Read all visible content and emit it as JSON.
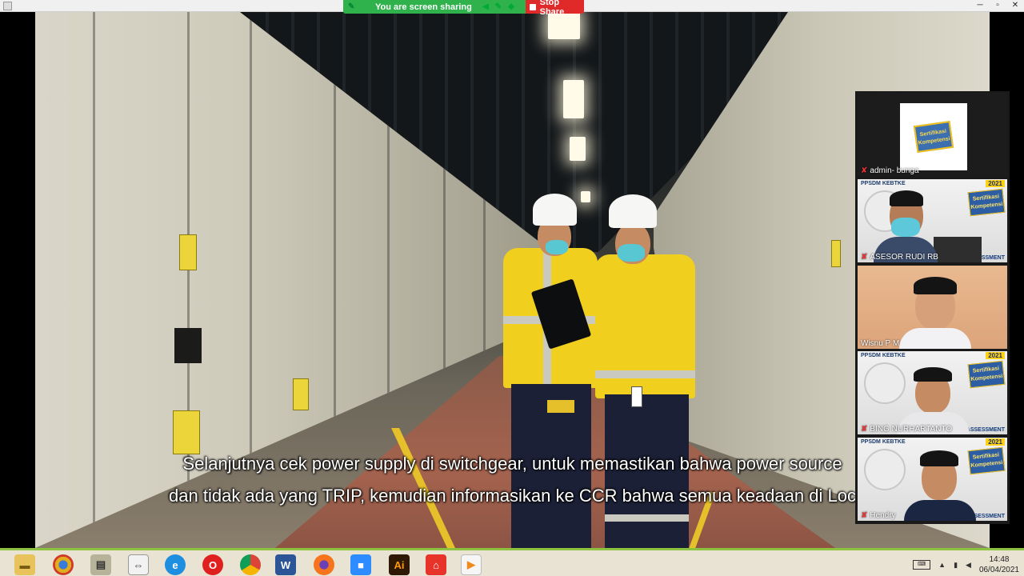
{
  "share_banner": {
    "status_text": "You are screen sharing",
    "stop_label": "Stop Share"
  },
  "subtitles": [
    "Selanjutnya cek power supply di switchgear, untuk memastikan bahwa power source",
    "dan tidak ada yang TRIP, kemudian informasikan ke CCR bahwa semua keadaan di Loc"
  ],
  "participants": [
    {
      "name": "admin- bunga",
      "muted": true,
      "kind": "logo",
      "logo_text": "Sertifikasi Kompetensi"
    },
    {
      "name": "ASESOR RUDI RB",
      "muted": true,
      "kind": "studio",
      "brand": "PPSDM KEBTKE",
      "year": "2021",
      "cert": "Sertifikasi Kompetensi",
      "dist": "DISTANCE ASSESSMENT"
    },
    {
      "name": "Wisnu P M",
      "muted": false,
      "kind": "room"
    },
    {
      "name": "BING NURHARTANTO",
      "muted": true,
      "kind": "studio",
      "brand": "PPSDM KEBTKE",
      "year": "2021",
      "cert": "Sertifikasi Kompetensi",
      "dist": "DISTANCE ASSESSMENT"
    },
    {
      "name": "Hendry",
      "muted": true,
      "kind": "studio",
      "brand": "PPSDM KEBTKE",
      "year": "2021",
      "cert": "Sertifikasi Kompetensi",
      "dist": "DISTANCE ASSESSMENT"
    }
  ],
  "taskbar": {
    "apps": [
      "file-explorer",
      "chrome-legacy",
      "archive-manager",
      "teamviewer",
      "internet-explorer",
      "opera",
      "chrome",
      "word",
      "firefox",
      "zoom",
      "illustrator",
      "acrobat",
      "media-player"
    ],
    "apps_labels": {
      "word": "W",
      "illustrator": "Ai"
    },
    "time": "14:48",
    "date": "06/04/2021"
  },
  "colors": {
    "share_green": "#2fb24c",
    "stop_red": "#e02a2a",
    "taskbar_accent": "#8cc43f",
    "safety_yellow": "#f0cf1f"
  }
}
